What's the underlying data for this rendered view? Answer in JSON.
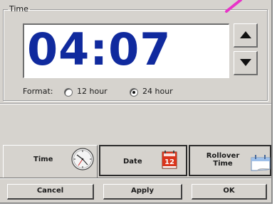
{
  "time_group": {
    "legend": "Time",
    "clock": "04:07",
    "format_label": "Format:",
    "options": [
      {
        "label": "12 hour",
        "checked": false
      },
      {
        "label": "24 hour",
        "checked": true
      }
    ],
    "spin_up_icon": "arrow-up-icon",
    "spin_down_icon": "arrow-down-icon"
  },
  "tabs": [
    {
      "label": "Time",
      "icon": "clock-icon",
      "active": true
    },
    {
      "label": "Date",
      "icon": "calendar-icon",
      "calendar_number": "12",
      "active": false
    },
    {
      "label_line1": "Rollover",
      "label_line2": "Time",
      "icon": "rollover-calendar-icon",
      "active": false
    }
  ],
  "buttons": {
    "cancel": "Cancel",
    "apply": "Apply",
    "ok": "OK"
  },
  "colors": {
    "clock_text": "#102a9e",
    "panel": "#d6d3ce",
    "annotation_stroke": "#e833c8",
    "calendar_red": "#d9341c"
  }
}
